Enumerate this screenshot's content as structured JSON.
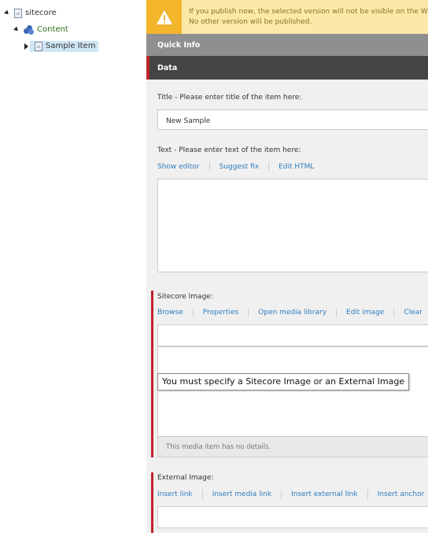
{
  "tree": {
    "root_label": "sitecore",
    "content_label": "Content",
    "sample_item_label": "Sample Item"
  },
  "warning": {
    "line1": "If you publish now, the selected version will not be visible on the W",
    "line2": "No other version will be published."
  },
  "sections": {
    "quick_info": "Quick Info",
    "data": "Data"
  },
  "fields": {
    "title": {
      "label": "Title - Please enter title of the item here:",
      "value": "New Sample"
    },
    "text": {
      "label": "Text - Please enter text of the item here:",
      "actions": [
        "Show editor",
        "Suggest fix",
        "Edit HTML"
      ]
    },
    "sitecore_image": {
      "label": "Sitecore Image:",
      "actions": [
        "Browse",
        "Properties",
        "Open media library",
        "Edit image",
        "Clear"
      ],
      "details": "This media item has no details."
    },
    "external_image": {
      "label": "External Image:",
      "actions": [
        "Insert link",
        "Insert media link",
        "Insert external link",
        "Insert anchor"
      ]
    }
  },
  "tooltip": "You must specify a Sitecore Image or an External Image",
  "colors": {
    "warning_bg": "#fce9a7",
    "warning_icon_bg": "#f2b52c",
    "quick_info_bg": "#8f8f8f",
    "data_bg": "#444444",
    "error_red": "#c0242b",
    "link_blue": "#2e7dbf"
  }
}
